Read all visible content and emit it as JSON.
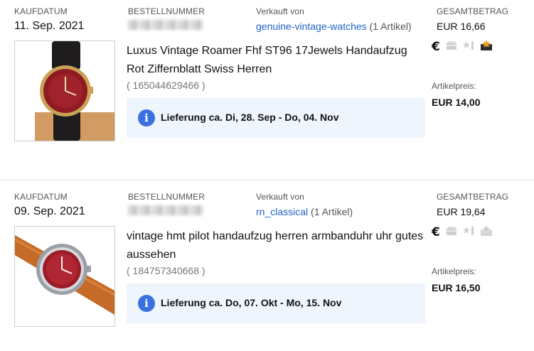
{
  "labels": {
    "purchase_date": "KAUFDATUM",
    "order_number": "BESTELLNUMMER",
    "sold_by": "Verkauft von",
    "total": "GESAMTBETRAG",
    "item_price": "Artikelpreis:"
  },
  "orders": [
    {
      "date": "11. Sep. 2021",
      "seller": "genuine-vintage-watches",
      "seller_count": "(1 Artikel)",
      "total": "EUR 16,66",
      "title": "Luxus Vintage Roamer Fhf ST96 17Jewels Handaufzug Rot Ziffernblatt Swiss Herren",
      "item_number": "( 165044629466 )",
      "delivery": "Lieferung ca. Di, 28. Sep - Do, 04. Nov",
      "unit_price": "EUR 14,00",
      "icons": [
        "euro-paid-icon",
        "shipped-icon",
        "feedback-icon",
        "feedback-received-icon"
      ],
      "feedback_highlight": true
    },
    {
      "date": "09. Sep. 2021",
      "seller": "rn_classical",
      "seller_count": "(1 Artikel)",
      "total": "EUR 19,64",
      "title": "vintage hmt pilot handaufzug herren armbanduhr uhr gutes aussehen",
      "item_number": "( 184757340668 )",
      "delivery": "Lieferung ca. Do, 07. Okt - Mo, 15. Nov",
      "unit_price": "EUR 16,50",
      "icons": [
        "euro-paid-icon",
        "shipped-icon",
        "feedback-icon",
        "feedback-received-icon"
      ],
      "feedback_highlight": false
    }
  ],
  "symbols": {
    "euro": "€",
    "info": "i"
  }
}
